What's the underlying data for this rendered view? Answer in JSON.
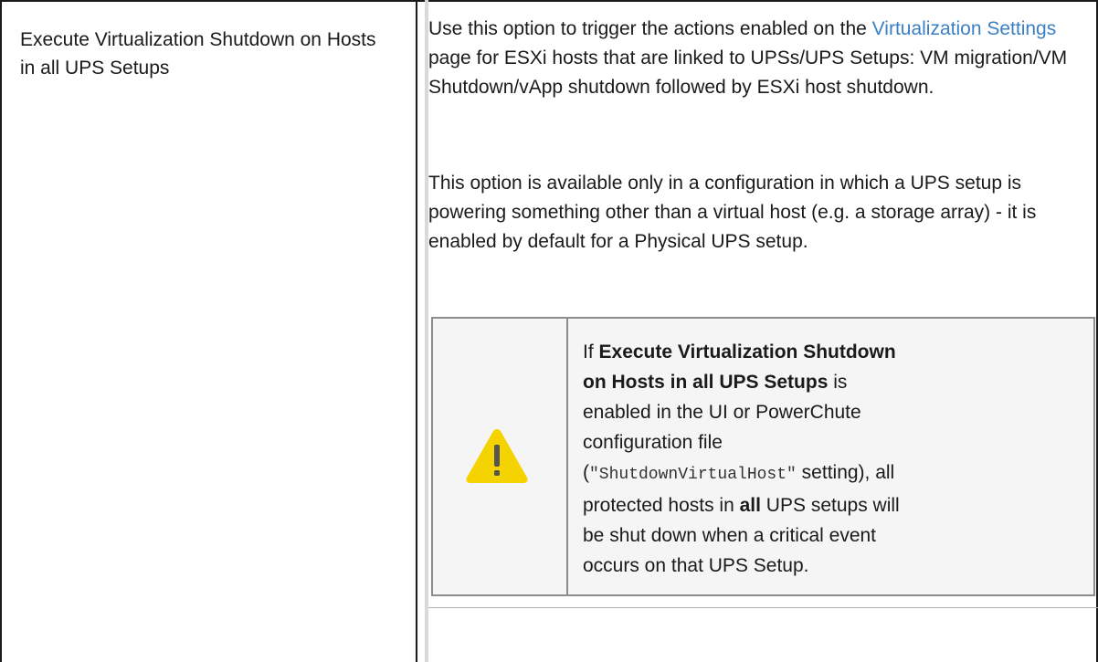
{
  "row": {
    "setting_name": "Execute Virtualization Shutdown on Hosts in all UPS Setups"
  },
  "description": {
    "p1_before_link": "Use this option to trigger the actions enabled on the ",
    "p1_link": "Virtualization Settings",
    "p1_after_link": " page for ESXi hosts that are linked to UPSs/UPS Setups: VM migration/VM Shutdown/vApp shutdown followed by ESXi host shutdown.",
    "p2": "This option is available only in a configuration in which a UPS setup is powering something other than a virtual host (e.g. a storage array) - it is enabled by default for a Physical UPS setup."
  },
  "note": {
    "icon": "warning-icon",
    "t1": "If ",
    "b1": "Execute Virtualization Shutdown on Hosts in all UPS Setups",
    "t2": " is enabled in the UI or PowerChute configuration file (",
    "code": "\"ShutdownVirtualHost\"",
    "t3": " setting), all protected hosts in ",
    "b2": "all",
    "t4": " UPS setups will be shut down when a critical event occurs on that UPS Setup."
  },
  "colors": {
    "link": "#3b7fc4",
    "warning_fill": "#f5d300",
    "warning_mark": "#555555"
  }
}
